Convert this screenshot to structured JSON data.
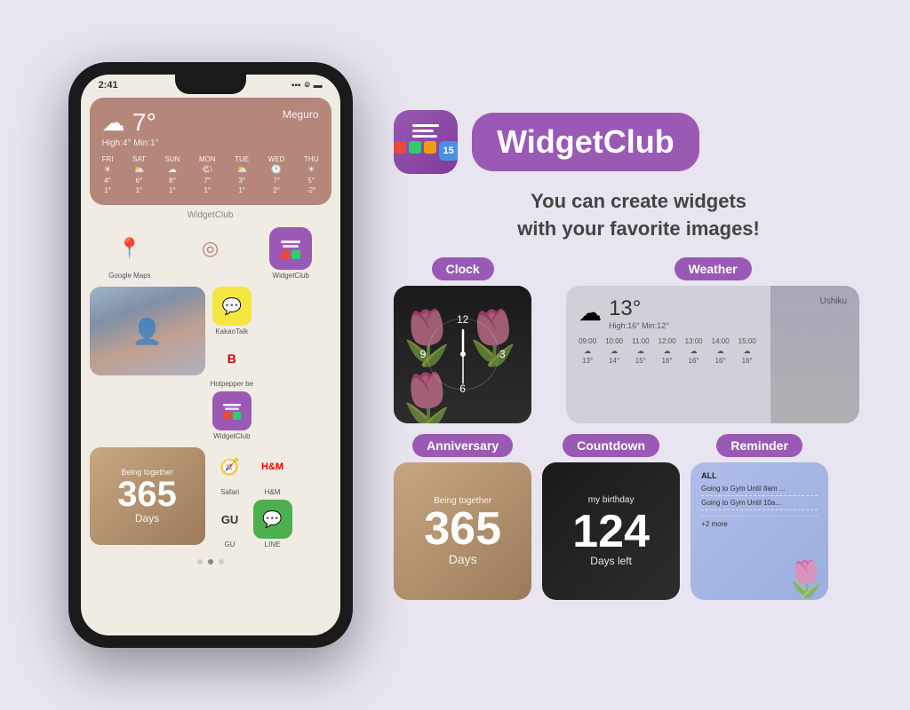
{
  "phone": {
    "status_time": "2:41",
    "weather": {
      "temp": "7°",
      "location": "Meguro",
      "hilo": "High:4° Min:1°",
      "days": [
        {
          "label": "FRI",
          "icon": "☀",
          "hi": "4°",
          "lo": "1°"
        },
        {
          "label": "SAT",
          "icon": "⛅",
          "hi": "6°",
          "lo": "1°"
        },
        {
          "label": "SUN",
          "icon": "☁",
          "hi": "8°",
          "lo": "1°"
        },
        {
          "label": "MON",
          "icon": "🌤",
          "hi": "7°",
          "lo": "1°"
        },
        {
          "label": "TUE",
          "icon": "⛅",
          "hi": "3°",
          "lo": "1°"
        },
        {
          "label": "WED",
          "icon": "🕐",
          "hi": "7°",
          "lo": "2°"
        },
        {
          "label": "THU",
          "icon": "☀",
          "hi": "5°",
          "lo": "-2°"
        }
      ]
    },
    "widgetclub_label": "WidgetClub",
    "apps_row1": [
      {
        "name": "Google Maps",
        "icon": "📍",
        "bg": "#f5f5f0"
      },
      {
        "name": "",
        "icon": "◎",
        "bg": "#f5f5f0"
      },
      {
        "name": "WidgetClub",
        "icon": "🟣",
        "bg": "#9b59b6"
      }
    ],
    "apps_row2": [
      {
        "name": "KakaoTalk",
        "icon": "💬",
        "bg": "#f5f5f0"
      },
      {
        "name": "Hotpepper be",
        "icon": "B",
        "bg": "#f5f5f0"
      },
      {
        "name": "WidgetClub",
        "icon": "🟣",
        "bg": "#9b59b6"
      }
    ],
    "anniversary": {
      "label": "Being together",
      "number": "365",
      "unit": "Days"
    },
    "apps_right": [
      {
        "name": "Safari",
        "icon": "🧭",
        "bg": "#f5f5f0"
      },
      {
        "name": "H&M",
        "icon": "H&M",
        "bg": "#f5f5f0"
      },
      {
        "name": "GU",
        "icon": "GU",
        "bg": "#f5f5f0"
      },
      {
        "name": "LINE",
        "icon": "💚",
        "bg": "#4CAF50"
      }
    ]
  },
  "app": {
    "name": "WidgetClub",
    "tagline_line1": "You can create widgets",
    "tagline_line2": "with your favorite images!"
  },
  "widgets": {
    "clock": {
      "badge": "Clock",
      "hour": "12",
      "minute_hand_angle": 180,
      "hour_hand_angle": 0
    },
    "weather": {
      "badge": "Weather",
      "location": "Ushiku",
      "temp": "13°",
      "hilo": "High:16°  Min:12°",
      "times": [
        "09:00",
        "10:00",
        "11:00",
        "12:00",
        "13:00",
        "14:00",
        "15:00"
      ],
      "temps": [
        "13°",
        "14°",
        "15°",
        "16°",
        "16°",
        "16°",
        "16°"
      ]
    },
    "anniversary": {
      "badge": "Anniversary",
      "label": "Being together",
      "number": "365",
      "unit": "Days"
    },
    "countdown": {
      "badge": "Countdown",
      "title": "my birthday",
      "number": "124",
      "unit": "Days left"
    },
    "reminder": {
      "badge": "Reminder",
      "all_label": "ALL",
      "items": [
        "Going to Gym Until 8am ...",
        "Going to Gym Until 10a...",
        ""
      ],
      "more": "+2 more"
    }
  }
}
